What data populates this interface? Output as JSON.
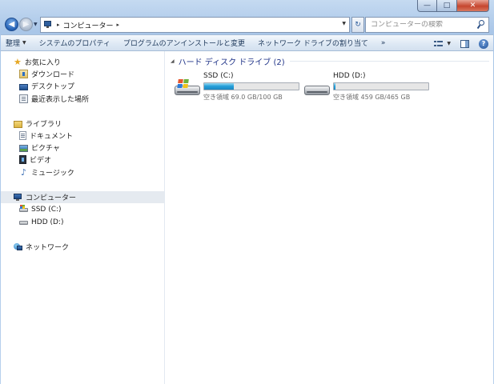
{
  "window": {
    "caption_buttons": {
      "minimize": "—",
      "maximize": "□",
      "close": "✕"
    }
  },
  "address_bar": {
    "crumb": "コンピューター",
    "separator": "▸"
  },
  "search": {
    "placeholder": "コンピューターの検索"
  },
  "toolbar": {
    "organize": "整理",
    "system_properties": "システムのプロパティ",
    "uninstall_programs": "プログラムのアンインストールと変更",
    "map_network_drive": "ネットワーク ドライブの割り当て",
    "more": "»",
    "help": "?"
  },
  "nav": {
    "favorites": {
      "label": "お気に入り",
      "items": [
        {
          "label": "ダウンロード",
          "icon": "downloads-folder-icon"
        },
        {
          "label": "デスクトップ",
          "icon": "desktop-icon"
        },
        {
          "label": "最近表示した場所",
          "icon": "recent-places-icon"
        }
      ]
    },
    "libraries": {
      "label": "ライブラリ",
      "items": [
        {
          "label": "ドキュメント",
          "icon": "documents-icon"
        },
        {
          "label": "ピクチャ",
          "icon": "pictures-icon"
        },
        {
          "label": "ビデオ",
          "icon": "videos-icon"
        },
        {
          "label": "ミュージック",
          "icon": "music-icon"
        }
      ]
    },
    "computer": {
      "label": "コンピューター",
      "items": [
        {
          "label": "SSD (C:)",
          "icon": "system-drive-icon"
        },
        {
          "label": "HDD (D:)",
          "icon": "hard-drive-icon"
        }
      ]
    },
    "network": {
      "label": "ネットワーク"
    }
  },
  "main": {
    "group_title": "ハード ディスク ドライブ (2)",
    "drives": [
      {
        "name": "SSD (C:)",
        "info": "空き領域 69.0 GB/100 GB",
        "used_fraction": 0.31,
        "icon": "system-drive-icon"
      },
      {
        "name": "HDD (D:)",
        "info": "空き領域 459 GB/465 GB",
        "used_fraction": 0.013,
        "icon": "hard-drive-icon"
      }
    ]
  },
  "colors": {
    "accent": "#1e3287",
    "bar_fill": "#26a0da",
    "selection": "#e5eaf0"
  }
}
